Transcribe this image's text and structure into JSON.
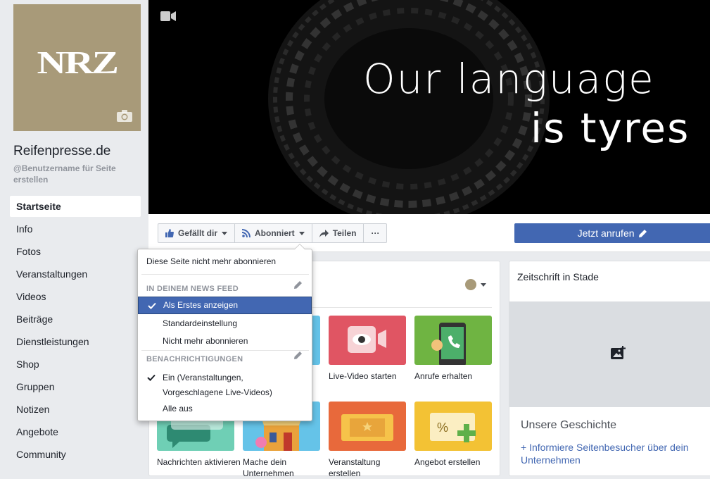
{
  "sidebar": {
    "avatar_logo": "NRZ",
    "page_name": "Reifenpresse.de",
    "username_prompt": "@Benutzername für Seite erstellen",
    "nav": [
      {
        "label": "Startseite",
        "active": true
      },
      {
        "label": "Info"
      },
      {
        "label": "Fotos"
      },
      {
        "label": "Veranstaltungen"
      },
      {
        "label": "Videos"
      },
      {
        "label": "Beiträge"
      },
      {
        "label": "Dienstleistungen"
      },
      {
        "label": "Shop"
      },
      {
        "label": "Gruppen"
      },
      {
        "label": "Notizen"
      },
      {
        "label": "Angebote"
      },
      {
        "label": "Community"
      }
    ]
  },
  "cover": {
    "line1": "Our language",
    "line2": "is tyres",
    "icon": "video-camera-icon"
  },
  "actions": {
    "like": "Gefällt dir",
    "follow": "Abonniert",
    "share": "Teilen",
    "more": "···",
    "call": "Jetzt anrufen"
  },
  "dropdown": {
    "unfollow": "Diese Seite nicht mehr abonnieren",
    "newsfeed_heading": "IN DEINEM NEWS FEED",
    "newsfeed_options": [
      "Als Erstes anzeigen",
      "Standardeinstellung",
      "Nicht mehr abonnieren"
    ],
    "selected_newsfeed": "Als Erstes anzeigen",
    "notifications_heading": "BENACHRICHTIGUNGEN",
    "notif_on_line1": "Ein (Veranstaltungen,",
    "notif_on_line2": "Vorgeschlagene Live-Videos)",
    "notif_off": "Alle aus"
  },
  "tiles": [
    {
      "label": "Live-Video starten",
      "color": "#e05563"
    },
    {
      "label": "Anrufe erhalten",
      "color": "#6fb442"
    },
    {
      "label": "Nachrichten aktivieren",
      "color": "#6fcfb5"
    },
    {
      "label": "Mache dein Unternehmen",
      "color": "#65c3e8"
    },
    {
      "label": "Veranstaltung erstellen",
      "color": "#e8693b"
    },
    {
      "label": "Angebot erstellen",
      "color": "#f3c234"
    }
  ],
  "right_panel": {
    "category": "Zeitschrift in Stade",
    "story_title": "Unsere Geschichte",
    "story_link": "+ Informiere Seitenbesucher über dein Unternehmen"
  },
  "colors": {
    "accent": "#4267b2",
    "avatar_bg": "#a89a79"
  }
}
